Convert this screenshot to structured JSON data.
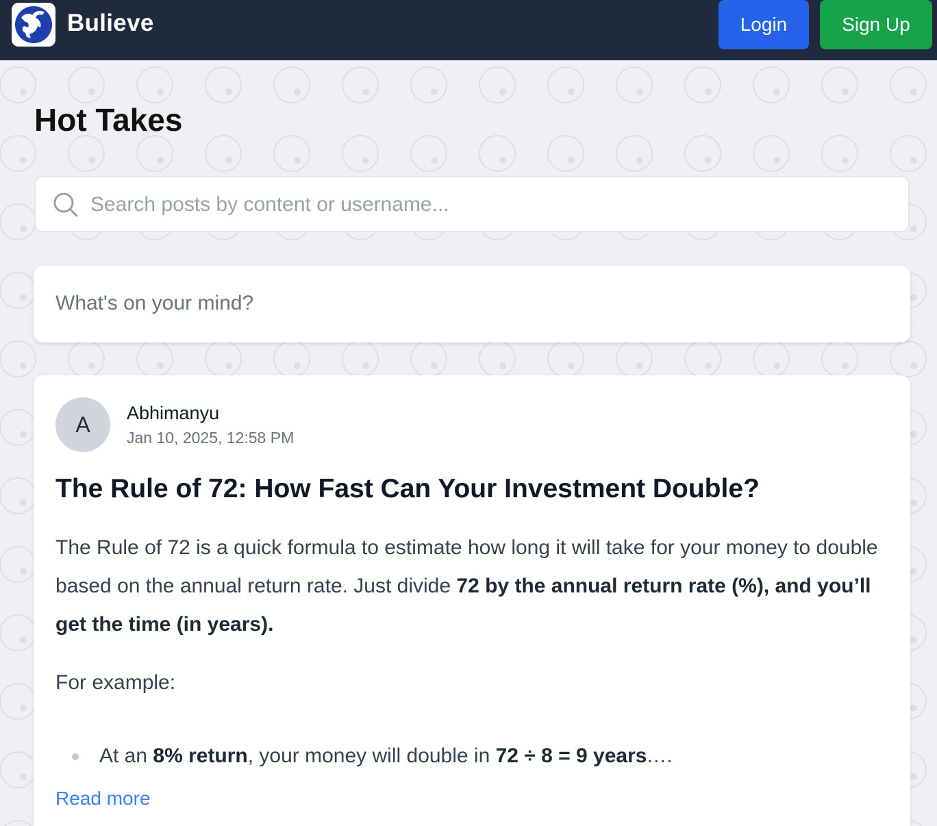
{
  "navbar": {
    "brand": "Bulieve",
    "logo_icon": "bull-icon",
    "login_label": "Login",
    "signup_label": "Sign Up",
    "colors": {
      "bg": "#1f2a3c",
      "login": "#2563eb",
      "signup": "#16a34a"
    }
  },
  "page": {
    "title": "Hot Takes"
  },
  "search": {
    "icon": "search-icon",
    "placeholder": "Search posts by content or username..."
  },
  "composer": {
    "placeholder": "What's on your mind?"
  },
  "post": {
    "avatar_initial": "A",
    "author": "Abhimanyu",
    "timestamp": "Jan 10, 2025, 12:58 PM",
    "title": "The Rule of 72: How Fast Can Your Investment Double?",
    "body_intro": "The Rule of 72 is a quick formula to estimate how long it will take for your money to double based on the annual return rate. Just divide ",
    "body_bold": "72 by the annual return rate (%), and you’ll get the time (in years).",
    "example_label": "For example:",
    "bullet": {
      "prefix": "At an ",
      "bold1": "8% return",
      "middle": ", your money will double in ",
      "bold2": "72 ÷ 8 = 9 years",
      "suffix": ".…"
    },
    "read_more": "Read more"
  }
}
